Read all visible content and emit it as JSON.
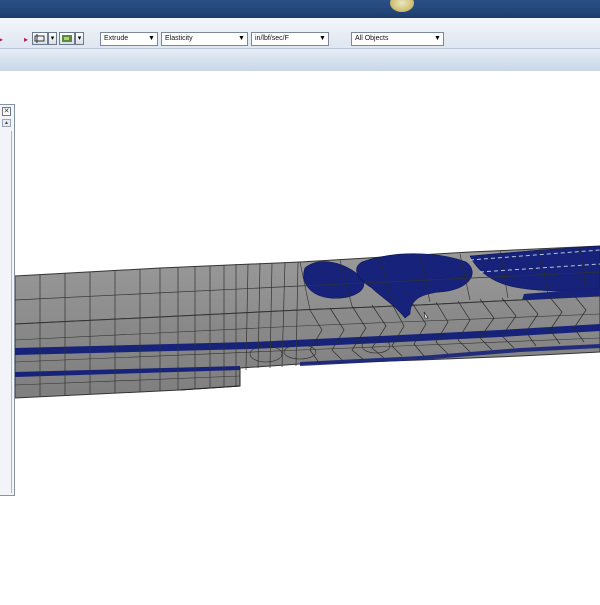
{
  "window": {
    "title_bar_color": "#24467a"
  },
  "toolbar": {
    "icons": [
      {
        "name": "arrow-right-icon",
        "glyph": "▸"
      },
      {
        "name": "arrow-right-icon",
        "glyph": "▸"
      }
    ],
    "buttons": [
      {
        "name": "view-tool-icon",
        "symbol": "selection-tool"
      },
      {
        "name": "dropdown-arrow-icon",
        "symbol": "▾"
      },
      {
        "name": "render-tool-icon",
        "symbol": "render-tool"
      },
      {
        "name": "dropdown-arrow-icon",
        "symbol": "▾"
      }
    ],
    "dropdowns": [
      {
        "id": "mode",
        "value": "Extrude"
      },
      {
        "id": "material",
        "value": "Elasticity"
      },
      {
        "id": "units",
        "value": "in/lbf/sec/F"
      },
      {
        "id": "objects",
        "value": "All Objects"
      }
    ]
  },
  "side_panel": {
    "close_glyph": "✕",
    "scroll_glyph": "▲"
  },
  "viewport": {
    "content": "3d-extruded-beam-mesh",
    "mesh_color": "#8f8f8f",
    "edge_color": "#2c2c2c",
    "highlight_color": "#17227a"
  }
}
